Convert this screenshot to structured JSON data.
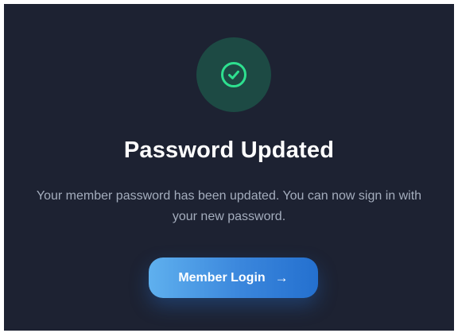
{
  "status": {
    "icon": "check-circle-icon",
    "icon_color": "#2ee08f",
    "title": "Password Updated",
    "message": "Your member password has been updated. You can now sign in with your new password."
  },
  "actions": {
    "login_label": "Member Login",
    "login_icon": "→"
  },
  "colors": {
    "background": "#1d2232",
    "accent_gradient_start": "#5fb0ee",
    "accent_gradient_end": "#2470cf"
  }
}
